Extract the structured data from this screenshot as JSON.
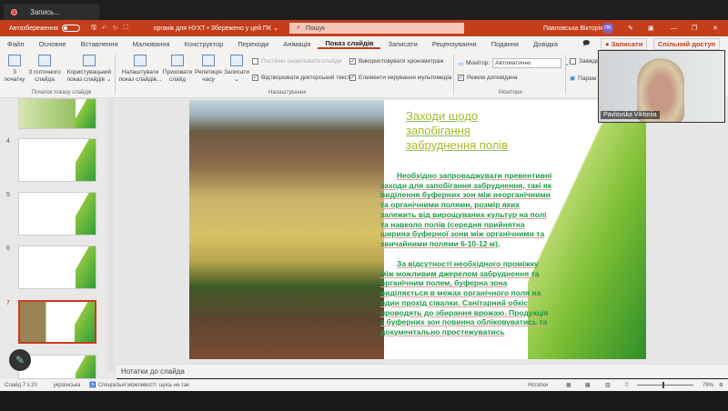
{
  "recorder": {
    "tab_label": "Запись..."
  },
  "titlebar": {
    "autosave": "Автозбереження",
    "doc_title": "органік для НУХТ • Збережено у цей ПК ⌄",
    "search_placeholder": "Пошук",
    "user_name": "Павловська Вікторія",
    "user_initials": "ПВ"
  },
  "tabs": [
    "Файл",
    "Основне",
    "Вставлення",
    "Малювання",
    "Конструктор",
    "Переходи",
    "Анімація",
    "Показ слайдів",
    "Записати",
    "Рецензування",
    "Подання",
    "Довідка"
  ],
  "ribbon_right": {
    "record": "● Записати",
    "share": "Спільний доступ"
  },
  "ribbon": {
    "from_start": "З початку",
    "from_current": "З поточного слайда",
    "custom": "Користувацький показ слайдів ⌄",
    "group1": "Початок показу слайдів",
    "setup": "Налаштувати показ слайдів...",
    "hide": "Приховати слайд",
    "rehearse": "Репетиція часу",
    "record": "Записати ⌄",
    "keep_updated": "Постійно оновлювати слайди",
    "play_narr": "Відтворювати дикторський текст",
    "use_timings": "Використовувати хронометраж",
    "media_controls": "Елементи керування мультимедіа",
    "group2": "Налаштування",
    "monitor_label": "Монітор:",
    "monitor_value": "Автоматично",
    "presenter_view": "Режим доповідача",
    "group3": "Монітори",
    "always": "Завжди",
    "params": "Парам"
  },
  "thumbs": [
    {
      "num": "4"
    },
    {
      "num": "5"
    },
    {
      "num": "6"
    },
    {
      "num": "7"
    }
  ],
  "slide": {
    "title": "Заходи щодо запобігання забруднення полів",
    "p1": "Необхідно запроваджувати превентивні заходи для запобігання забруднення, такі як виділення буферних зон між неорганічними та органічними полями, розмір яких залежить від вирощуваних культур на полі та навколо полів (середня прийнятна ширина буферної зони між органічними та звичайними полями 6-10-12 м).",
    "p2": "За відсутності необхідного проміжку між можливим джерелом забруднення та органічним полем, буферна зона виділяється в межах органічного поля на один прохід сівалки. Санітарний обкіс проводять до збирання врожаю. Продукція з буферних зон повинна обліковуватись та документально простежуватись"
  },
  "notes": "Нотатки до слайда",
  "status": {
    "slide": "Слайд 7 з 20",
    "lang": "українська",
    "access": "Спеціальні можливості: щось не так",
    "notes": "Нотатки",
    "zoom": "76%"
  },
  "webcam": {
    "name": "Pavlovska Viktoriia"
  }
}
